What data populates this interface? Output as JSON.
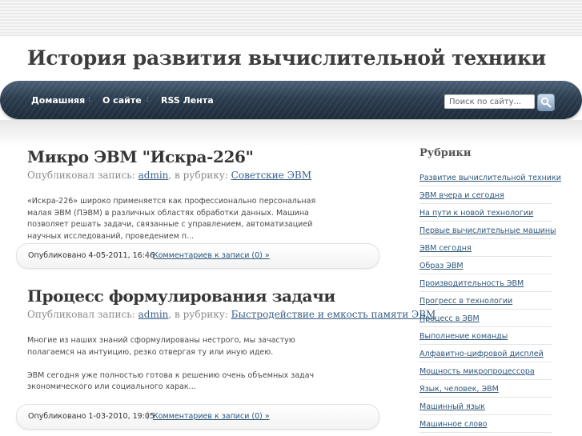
{
  "site": {
    "title": "История развития вычислительной техники"
  },
  "nav": {
    "items": [
      {
        "label": "Домашняя"
      },
      {
        "label": "О сайте"
      },
      {
        "label": "RSS Лента"
      }
    ],
    "separator": ":"
  },
  "search": {
    "placeholder": "Поиск по сайту..."
  },
  "posts": [
    {
      "title": "Микро ЭВМ \"Искра-226\"",
      "meta_prefix": "Опубликовал запись: ",
      "author": "admin",
      "meta_middle": ", в рубрику: ",
      "category": "Советские ЭВМ",
      "excerpt": [
        "«Искра-226» широко применяется как профессионально персональная малая ЭВМ (ПЭВМ) в различных областях обработки данных. Машина позволяет решать задачи, связанные с управлением, автоматизацией научных исследований, проведением п..."
      ],
      "date": "Опубликовано 4-05-2011, 16:46",
      "comments": "Комментариев к записи (0) »"
    },
    {
      "title": "Процесс формулирования задачи",
      "meta_prefix": "Опубликовал запись: ",
      "author": "admin",
      "meta_middle": ", в рубрику: ",
      "category": "Быстродействие и емкость памяти ЭВМ",
      "excerpt": [
        "Многие из наших знаний сформулированы нестрого, мы зачастую полагаемся на интуицию, резко отвергая ту или иную идею.",
        "ЭВМ сегодня уже полностью готова к решению очень объемных задач экономического или социального харак..."
      ],
      "date": "Опубликовано 1-03-2010, 19:05",
      "comments": "Комментариев к записи (0) »"
    }
  ],
  "footer_separator": "|",
  "sidebar": {
    "title": "Рубрики",
    "categories": [
      "Развитие вычислительной техники",
      "ЭВМ вчера и сегодня",
      "На пути к новой технологии",
      "Первые вычислительные машины",
      "ЭВМ сегодня",
      "Образ ЭВМ",
      "Производительность ЭВМ",
      "Прогресс в технологии",
      "Процесс в ЭВМ",
      "Выполнение команды",
      "Алфавитно-цифровой дисплей",
      "Мощность микропроцессора",
      "Язык, человек, ЭВМ",
      "Машинный язык",
      "Машинное слово"
    ]
  }
}
